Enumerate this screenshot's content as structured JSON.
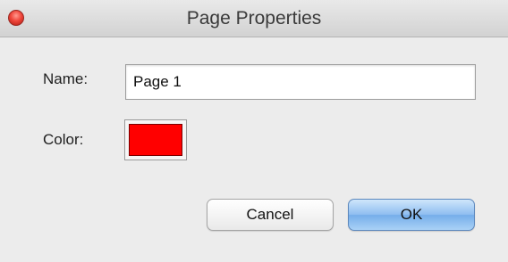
{
  "window": {
    "title": "Page Properties",
    "close_icon": "close-icon"
  },
  "form": {
    "name_label": "Name:",
    "name_value": "Page 1",
    "color_label": "Color:",
    "color_value": "#ff0000"
  },
  "buttons": {
    "cancel_label": "Cancel",
    "ok_label": "OK"
  },
  "colors": {
    "background": "#ececec",
    "default_button": "#75aeea"
  }
}
